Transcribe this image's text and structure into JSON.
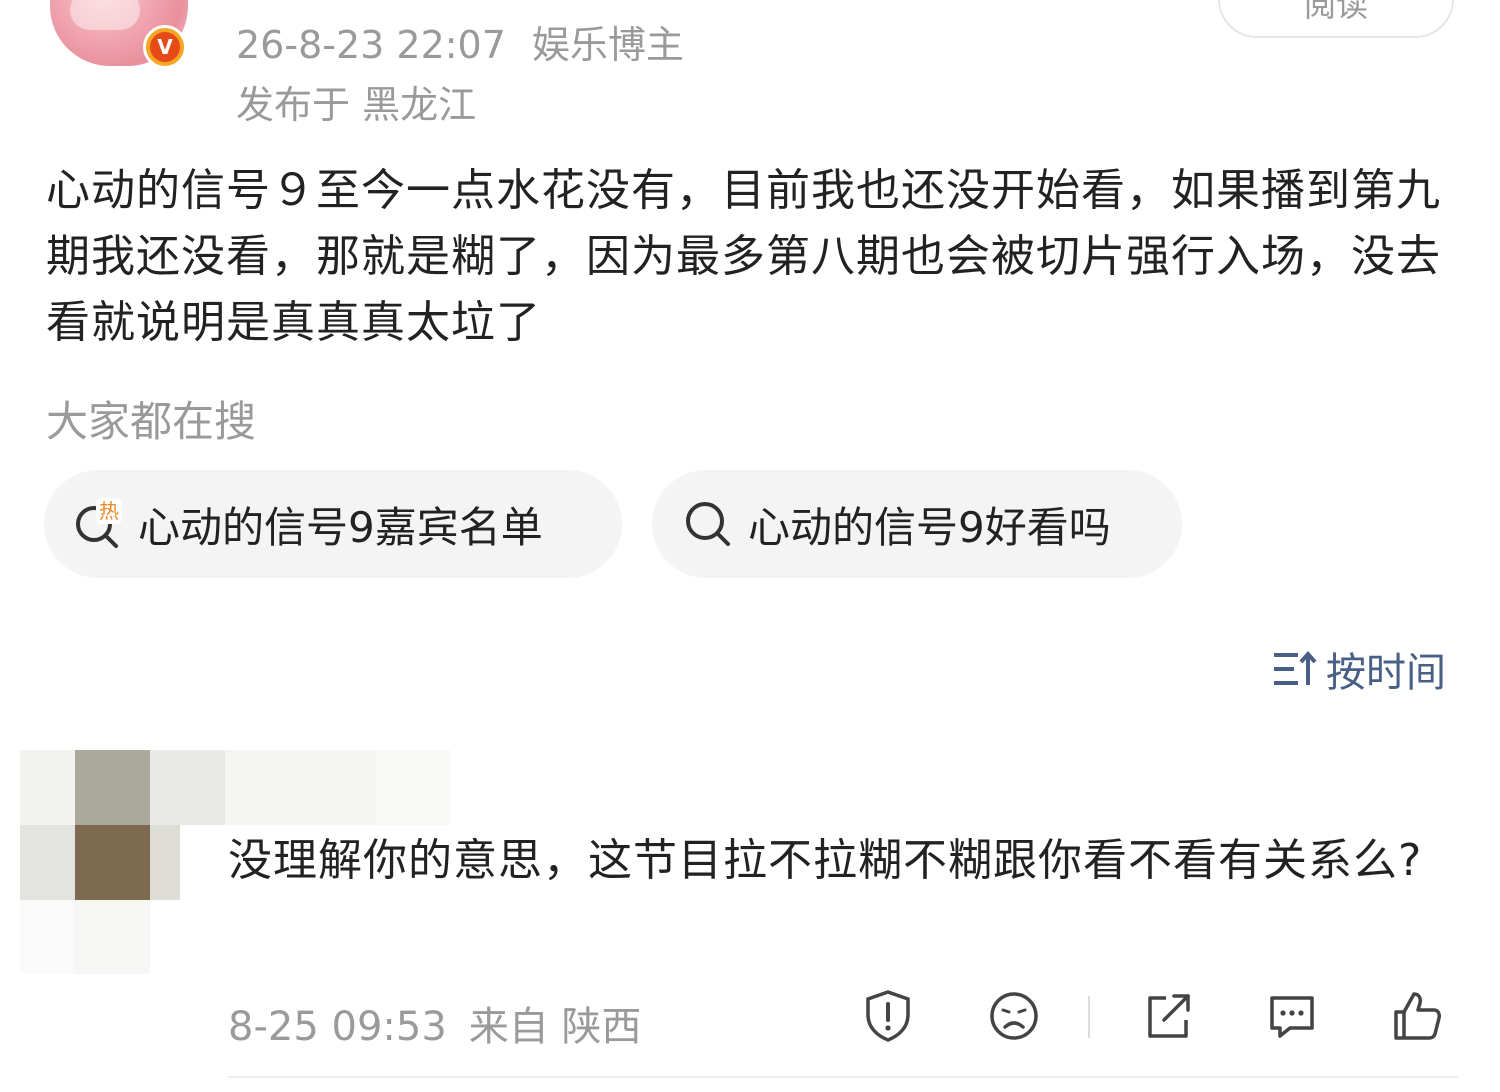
{
  "post": {
    "date": "26-8-23 22:07",
    "category": "娱乐博主",
    "location": "发布于 黑龙江",
    "read_label": "阅读",
    "verified_mark": "V",
    "text": "心动的信号９至今一点水花没有，目前我也还没开始看，如果播到第九期我还没看，那就是糊了，因为最多第八期也会被切片强行入场，没去看就说明是真真真太垃了"
  },
  "search": {
    "title": "大家都在搜",
    "chips": [
      {
        "label": "心动的信号9嘉宾名单",
        "icon": "hot-search-icon",
        "badge": "热",
        "badge_color": "#f08a24"
      },
      {
        "label": "心动的信号9好看吗",
        "icon": "search-icon"
      }
    ]
  },
  "sort": {
    "label": "按时间",
    "icon": "sort-icon",
    "color": "#4a5f86"
  },
  "comment": {
    "text": "没理解你的意思，这节目拉不拉糊不糊跟你看不看有关系么?",
    "date": "8-25 09:53",
    "from": "来自 陕西",
    "actions": [
      "report-icon",
      "dislike-icon",
      "share-icon",
      "reply-icon",
      "like-icon"
    ]
  }
}
